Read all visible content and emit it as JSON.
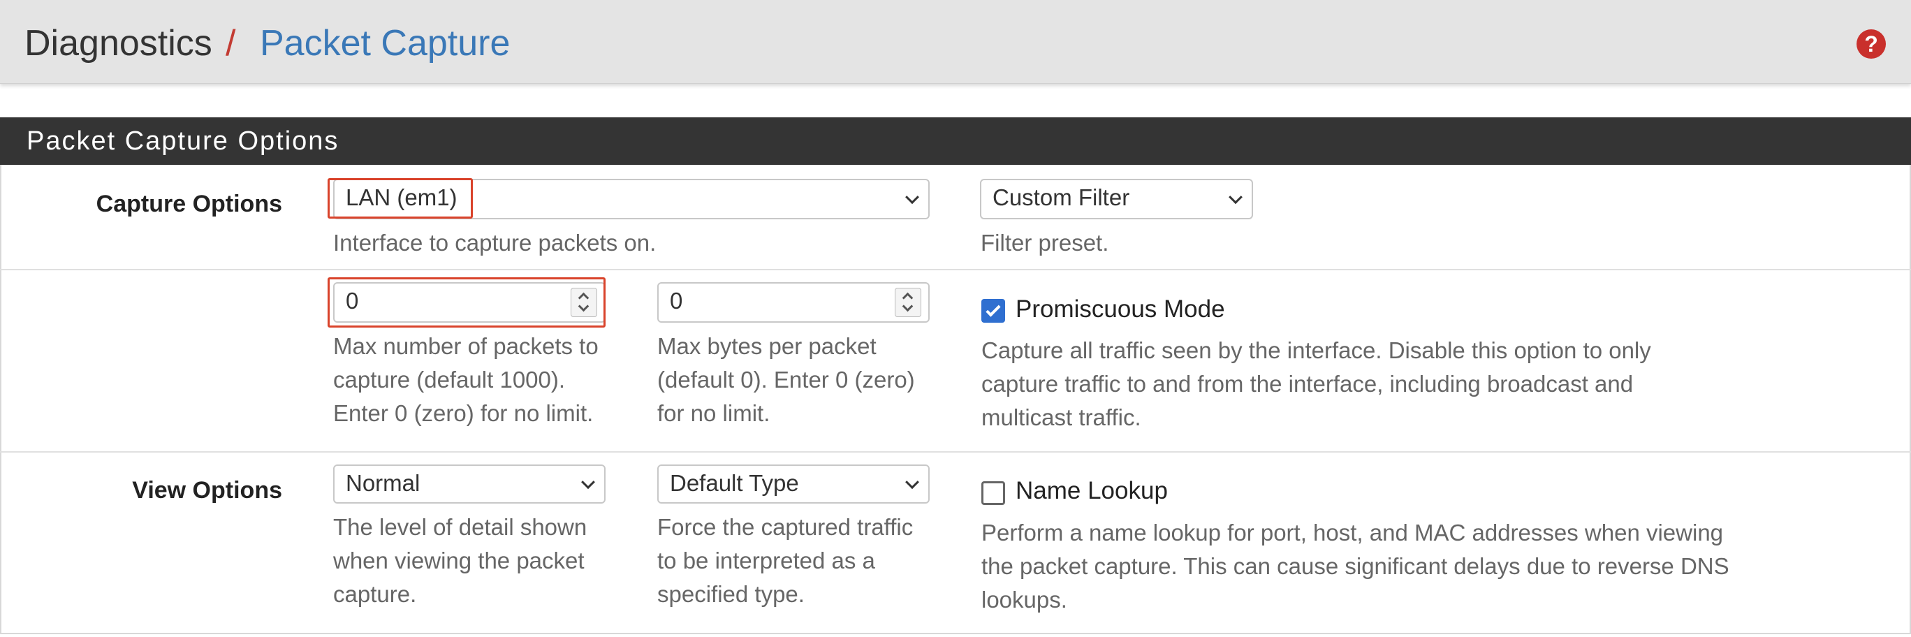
{
  "header": {
    "breadcrumb_parent": "Diagnostics",
    "breadcrumb_separator": "/",
    "breadcrumb_current": "Packet Capture",
    "help_icon_glyph": "?"
  },
  "panel": {
    "title": "Packet Capture Options"
  },
  "capture_options": {
    "label": "Capture Options",
    "interface_select": {
      "value": "LAN (em1)",
      "help": "Interface to capture packets on."
    },
    "filter_select": {
      "value": "Custom Filter",
      "help": "Filter preset."
    }
  },
  "limits": {
    "max_packets": {
      "value": "0",
      "help_lines": [
        "Max number of packets to",
        "capture (default 1000).",
        "Enter 0 (zero) for no limit."
      ]
    },
    "max_bytes": {
      "value": "0",
      "help_lines": [
        "Max bytes per packet",
        "(default 0). Enter 0 (zero)",
        "for no limit."
      ]
    },
    "promiscuous": {
      "label": "Promiscuous Mode",
      "checked": true,
      "help_lines": [
        "Capture all traffic seen by the interface. Disable this option to only",
        "capture traffic to and from the interface, including broadcast and",
        "multicast traffic."
      ]
    }
  },
  "view_options": {
    "label": "View Options",
    "detail_select": {
      "value": "Normal",
      "help_lines": [
        "The level of detail shown",
        "when viewing the packet",
        "capture."
      ]
    },
    "type_select": {
      "value": "Default Type",
      "help_lines": [
        "Force the captured traffic",
        "to be interpreted as a",
        "specified type."
      ]
    },
    "name_lookup": {
      "label": "Name Lookup",
      "checked": false,
      "help_lines": [
        "Perform a name lookup for port, host, and MAC addresses when viewing",
        "the packet capture. This can cause significant delays due to reverse DNS",
        "lookups."
      ]
    }
  },
  "colors": {
    "accent_blue": "#3a78b7",
    "separator_red": "#c33c33",
    "highlight_red": "#d9432b",
    "panel_header": "#343434",
    "checkbox_blue": "#2f6fd0"
  }
}
